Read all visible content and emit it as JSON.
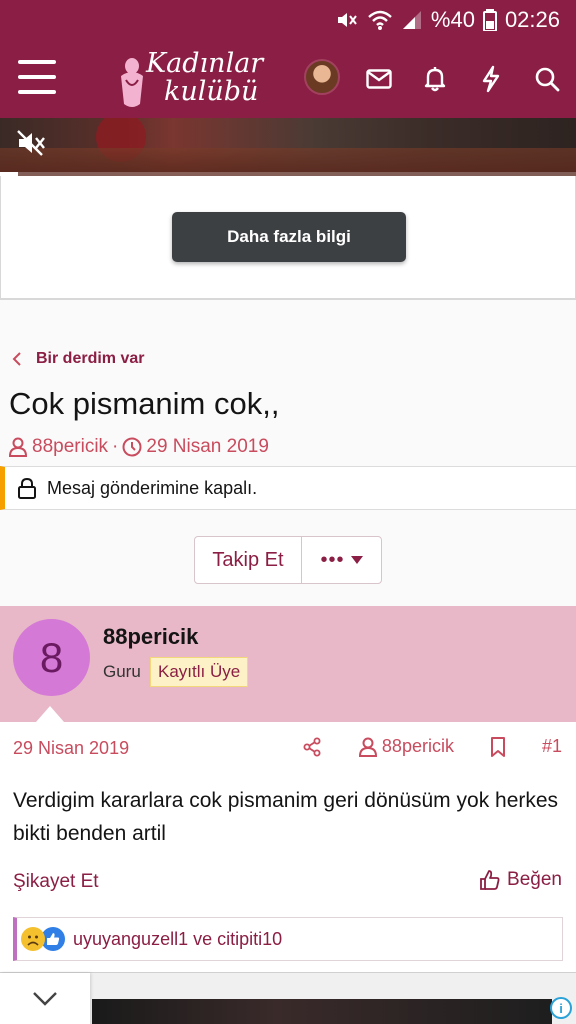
{
  "status_bar": {
    "battery_label": "%40",
    "time": "02:26",
    "icons": [
      "mute-icon",
      "wifi-icon",
      "signal-icon",
      "battery-icon"
    ]
  },
  "header": {
    "logo_line1": "Kadınlar",
    "logo_line2": "kulübü",
    "icons": [
      "menu-icon",
      "avatar",
      "mail-icon",
      "bell-icon",
      "bolt-icon",
      "search-icon"
    ]
  },
  "ad": {
    "button_label": "Daha fazla bilgi"
  },
  "breadcrumb": {
    "label": "Bir derdim var"
  },
  "thread": {
    "title": "Cok pismanim cok,,",
    "author": "88pericik",
    "separator": "·",
    "date": "29 Nisan 2019",
    "notice": "Mesaj gönderimine kapalı."
  },
  "actions": {
    "follow_label": "Takip Et",
    "more_label": "•••"
  },
  "post": {
    "avatar_letter": "8",
    "username": "88pericik",
    "rank": "Guru",
    "badge": "Kayıtlı Üye",
    "date": "29 Nisan 2019",
    "author_link": "88pericik",
    "post_number": "#1",
    "body": "Verdigim kararlara cok pismanim geri dönüsüm yok herkes bikti benden artil",
    "report_label": "Şikayet Et",
    "like_label": "Beğen",
    "reaction_users": "uyuyanguzell1 ve citipiti10"
  },
  "colors": {
    "brand": "#8b1e44",
    "accent_text": "#c84c5e",
    "post_header_bg": "#e8b8c8",
    "notice_border": "#f5a000"
  }
}
